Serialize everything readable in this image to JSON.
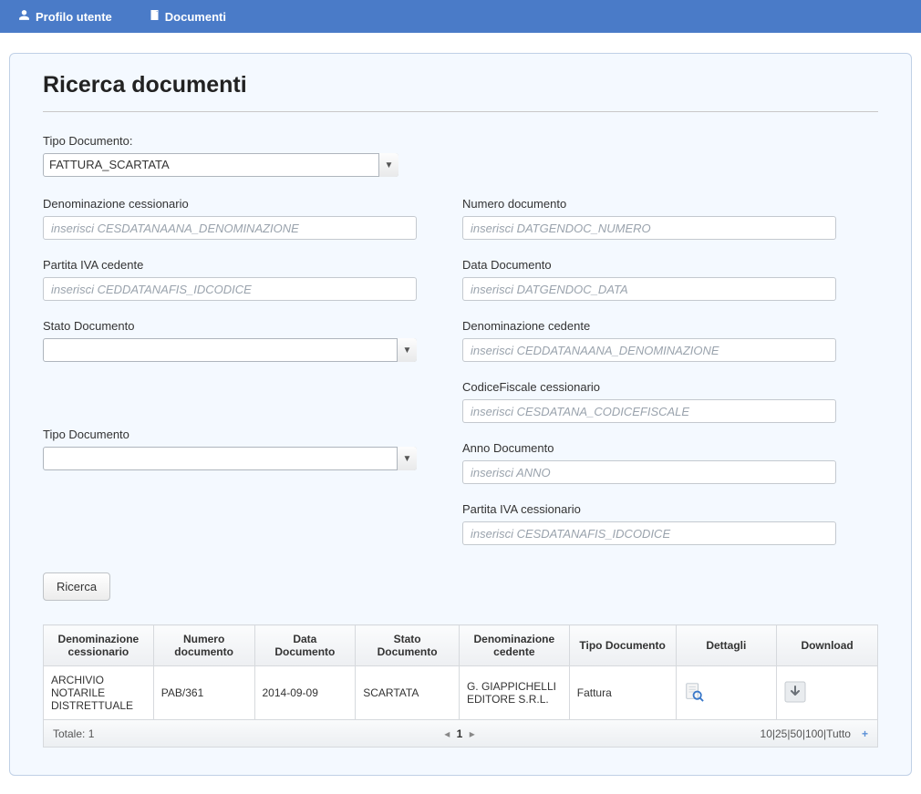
{
  "nav": {
    "profile": "Profilo utente",
    "documents": "Documenti"
  },
  "title": "Ricerca documenti",
  "form": {
    "tipo_documento_top": {
      "label": "Tipo Documento:",
      "value": "FATTURA_SCARTATA"
    },
    "denominazione_cessionario": {
      "label": "Denominazione cessionario",
      "placeholder": "inserisci CESDATANAANA_DENOMINAZIONE"
    },
    "partita_iva_cedente": {
      "label": "Partita IVA cedente",
      "placeholder": "inserisci CEDDATANAFIS_IDCODICE"
    },
    "stato_documento": {
      "label": "Stato Documento",
      "value": ""
    },
    "tipo_documento_bottom": {
      "label": "Tipo Documento",
      "value": ""
    },
    "numero_documento": {
      "label": "Numero documento",
      "placeholder": "inserisci DATGENDOC_NUMERO"
    },
    "data_documento": {
      "label": "Data Documento",
      "placeholder": "inserisci DATGENDOC_DATA"
    },
    "denominazione_cedente": {
      "label": "Denominazione cedente",
      "placeholder": "inserisci CEDDATANAANA_DENOMINAZIONE"
    },
    "codice_fiscale_cessionario": {
      "label": "CodiceFiscale cessionario",
      "placeholder": "inserisci CESDATANA_CODICEFISCALE"
    },
    "anno_documento": {
      "label": "Anno Documento",
      "placeholder": "inserisci ANNO"
    },
    "partita_iva_cessionario": {
      "label": "Partita IVA cessionario",
      "placeholder": "inserisci CESDATANAFIS_IDCODICE"
    }
  },
  "search_button": "Ricerca",
  "table": {
    "headers": {
      "denominazione_cessionario": "Denominazione cessionario",
      "numero_documento": "Numero documento",
      "data_documento": "Data Documento",
      "stato_documento": "Stato Documento",
      "denominazione_cedente": "Denominazione cedente",
      "tipo_documento": "Tipo Documento",
      "dettagli": "Dettagli",
      "download": "Download"
    },
    "rows": [
      {
        "denominazione_cessionario": "ARCHIVIO NOTARILE DISTRETTUALE",
        "numero_documento": "PAB/361",
        "data_documento": "2014-09-09",
        "stato_documento": "SCARTATA",
        "denominazione_cedente": "G. GIAPPICHELLI EDITORE S.R.L.",
        "tipo_documento": "Fattura"
      }
    ],
    "footer": {
      "total_label": "Totale: 1",
      "current_page": "1",
      "page_sizes": "10|25|50|100|Tutto"
    }
  }
}
